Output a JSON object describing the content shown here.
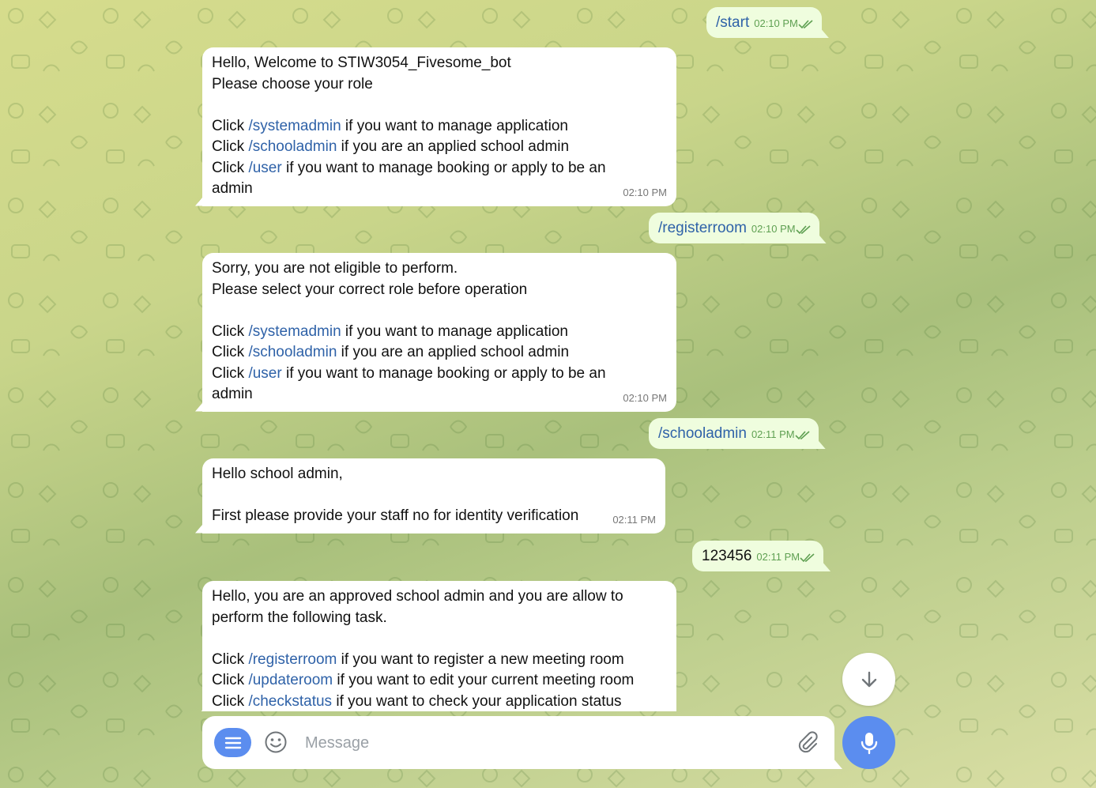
{
  "messages": [
    {
      "dir": "out",
      "text": "/start",
      "time": "02:10 PM"
    },
    {
      "dir": "in",
      "time": "02:10 PM",
      "lines": [
        [
          {
            "t": "Hello, Welcome to STIW3054_Fivesome_bot"
          }
        ],
        [
          {
            "t": "Please choose your role"
          }
        ],
        [],
        [
          {
            "t": "Click "
          },
          {
            "t": "/systemadmin",
            "cmd": true
          },
          {
            "t": " if you want to manage application"
          }
        ],
        [
          {
            "t": "Click "
          },
          {
            "t": "/schooladmin",
            "cmd": true
          },
          {
            "t": " if you are an applied school admin"
          }
        ],
        [
          {
            "t": "Click "
          },
          {
            "t": "/user",
            "cmd": true
          },
          {
            "t": " if you want to manage booking or apply to be an"
          }
        ],
        [
          {
            "t": "admin"
          }
        ]
      ]
    },
    {
      "dir": "out",
      "text": "/registerroom",
      "time": "02:10 PM"
    },
    {
      "dir": "in",
      "time": "02:10 PM",
      "lines": [
        [
          {
            "t": "Sorry, you are not eligible to perform."
          }
        ],
        [
          {
            "t": "Please select your correct role before operation"
          }
        ],
        [],
        [
          {
            "t": "Click "
          },
          {
            "t": "/systemadmin",
            "cmd": true
          },
          {
            "t": " if you want to manage application"
          }
        ],
        [
          {
            "t": "Click "
          },
          {
            "t": "/schooladmin",
            "cmd": true
          },
          {
            "t": " if you are an applied school admin"
          }
        ],
        [
          {
            "t": "Click "
          },
          {
            "t": "/user",
            "cmd": true
          },
          {
            "t": " if you want to manage booking or apply to be an"
          }
        ],
        [
          {
            "t": "admin"
          }
        ]
      ]
    },
    {
      "dir": "out",
      "text": "/schooladmin",
      "time": "02:11 PM"
    },
    {
      "dir": "in",
      "time": "02:11 PM",
      "lines": [
        [
          {
            "t": "Hello school admin,"
          }
        ],
        [],
        [
          {
            "t": "First please provide your staff no for identity verification"
          }
        ]
      ]
    },
    {
      "dir": "out",
      "text": "123456",
      "time": "02:11 PM",
      "plain": true
    },
    {
      "dir": "in",
      "time": "",
      "lines": [
        [
          {
            "t": "Hello, you are an approved school admin and you are allow to"
          }
        ],
        [
          {
            "t": "perform the following task."
          }
        ],
        [],
        [
          {
            "t": "Click "
          },
          {
            "t": "/registerroom",
            "cmd": true
          },
          {
            "t": " if you want to register a new meeting room"
          }
        ],
        [
          {
            "t": "Click "
          },
          {
            "t": "/updateroom",
            "cmd": true
          },
          {
            "t": " if you want to edit your current meeting room"
          }
        ],
        [
          {
            "t": "Click "
          },
          {
            "t": "/checkstatus",
            "cmd": true
          },
          {
            "t": " if you want to check your application status"
          }
        ]
      ]
    }
  ],
  "composer": {
    "placeholder": "Message",
    "menu_icon": "menu-icon",
    "emoji_icon": "smile-icon",
    "attach_icon": "paperclip-icon",
    "mic_icon": "microphone-icon",
    "scroll_icon": "arrow-down-icon"
  },
  "colors": {
    "accent": "#5b8def",
    "command": "#2f62a8",
    "outgoing_bubble": "#effdde",
    "outgoing_time": "#5fa052"
  }
}
